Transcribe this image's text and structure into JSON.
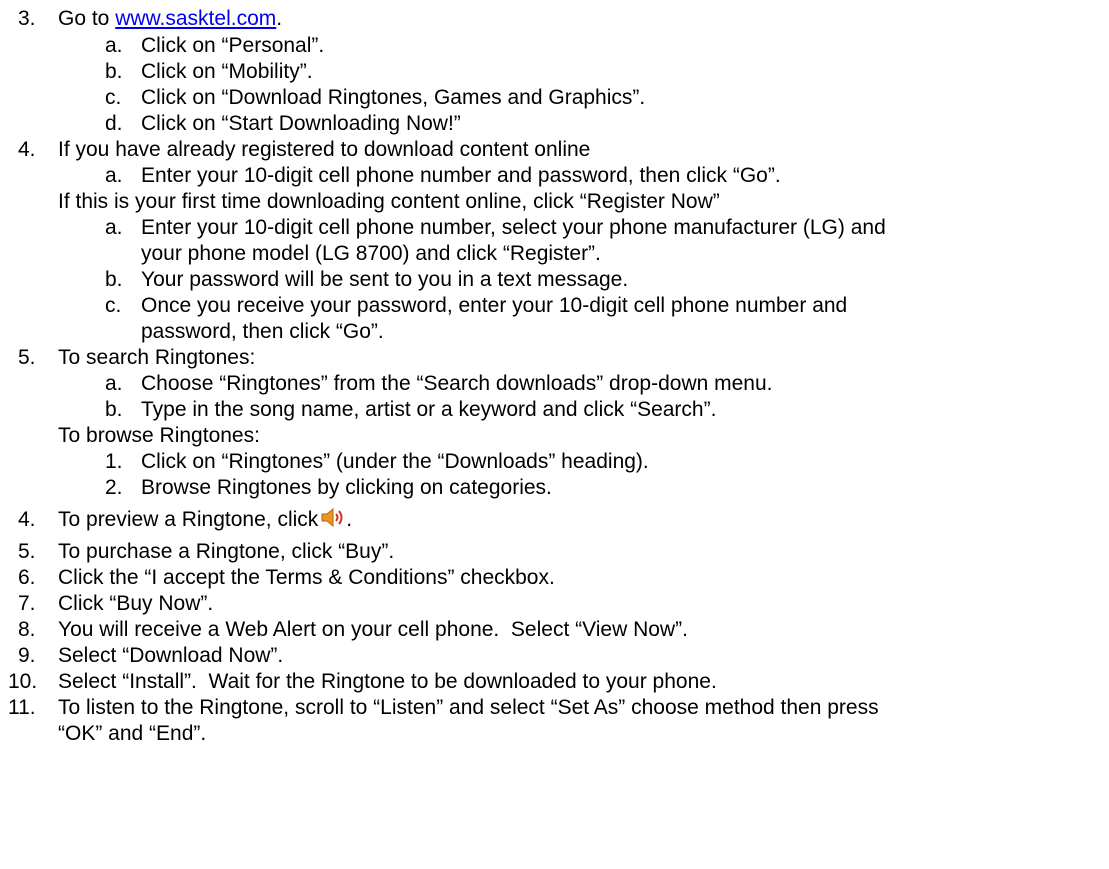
{
  "doc": {
    "s3": {
      "num": "3.",
      "pre": "Go to ",
      "link": "www.sasktel.com",
      "post": ".",
      "a": {
        "num": "a.",
        "text": "Click on “Personal”."
      },
      "b": {
        "num": "b.",
        "text": "Click on “Mobility”."
      },
      "c": {
        "num": "c.",
        "text": "Click on “Download Ringtones, Games and Graphics”."
      },
      "d": {
        "num": "d.",
        "text": "Click on “Start Downloading Now!”"
      }
    },
    "s4": {
      "num": "4.",
      "text": "If you have already registered to download content online",
      "a": {
        "num": "a.",
        "text": "Enter your 10-digit cell phone number and password, then click “Go”."
      },
      "first_time": "If this is your first time downloading content online, click “Register Now”",
      "fa": {
        "num": "a.",
        "line1": "Enter your 10-digit cell phone number, select your phone manufacturer (LG) and",
        "line2": "your phone model (LG 8700) and click “Register”."
      },
      "fb": {
        "num": "b.",
        "text": "Your password will be sent to you in a text message."
      },
      "fc": {
        "num": "c.",
        "line1": "Once you receive your password, enter your 10-digit cell phone number and",
        "line2": "password, then click “Go”."
      }
    },
    "s5": {
      "num": "5.",
      "text": "To search Ringtones:",
      "a": {
        "num": "a.",
        "text": "Choose “Ringtones” from the “Search downloads” drop-down menu."
      },
      "b": {
        "num": "b.",
        "text": "Type in the song name, artist or a keyword and click “Search”."
      },
      "browse": "To browse Ringtones:",
      "b1": {
        "num": "1.",
        "text": "Click on “Ringtones” (under the “Downloads” heading)."
      },
      "b2": {
        "num": "2.",
        "text": "Browse Ringtones by clicking on categories."
      }
    },
    "r4": {
      "num": "4.",
      "pre": "To preview a Ringtone, click",
      "post": "."
    },
    "r5": {
      "num": "5.",
      "text": "To purchase a Ringtone, click “Buy”."
    },
    "r6": {
      "num": "6.",
      "text": "Click the “I accept the Terms & Conditions” checkbox."
    },
    "r7": {
      "num": "7.",
      "text": "Click “Buy Now”."
    },
    "r8": {
      "num": "8.",
      "text": "You will receive a Web Alert on your cell phone.  Select “View Now”."
    },
    "r9": {
      "num": "9.",
      "text": "Select “Download Now”."
    },
    "r10": {
      "num": "10.",
      "text": "Select “Install”.  Wait for the Ringtone to be downloaded to your phone."
    },
    "r11": {
      "num": "11.",
      "line1": "To listen to the Ringtone, scroll to “Listen” and select “Set As” choose method then press",
      "line2": "“OK” and “End”."
    }
  },
  "icons": {
    "speaker": "speaker-volume-icon"
  },
  "colors": {
    "link": "#0000ee",
    "speaker_body": "#e8961e",
    "speaker_waves": "#d4301a"
  }
}
